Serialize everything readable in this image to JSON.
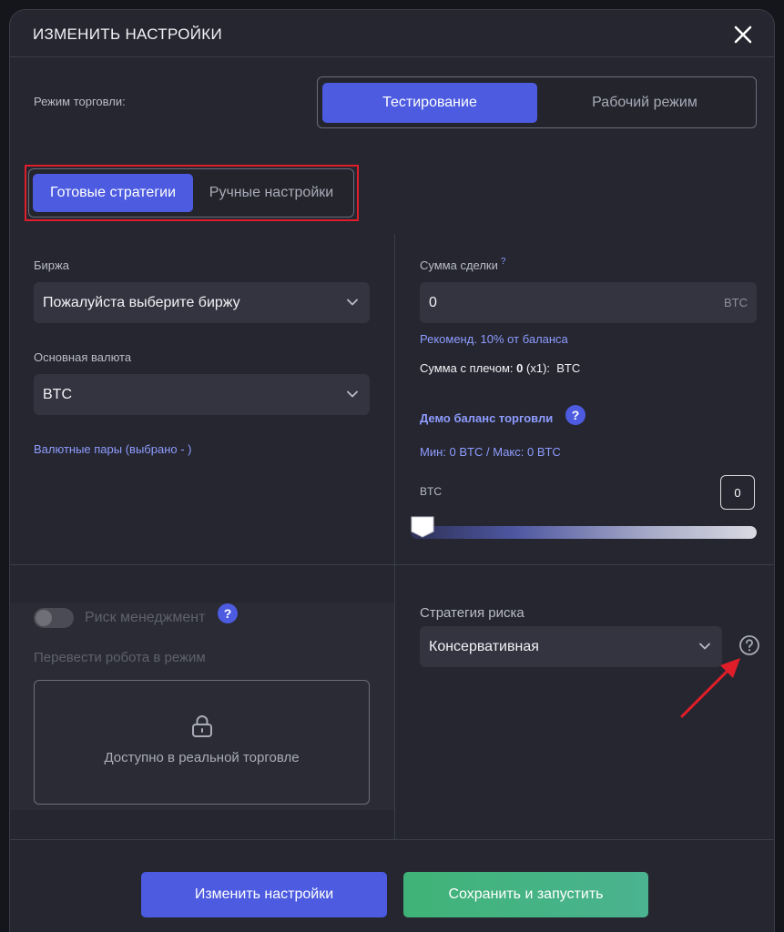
{
  "modal": {
    "title": "ИЗМЕНИТЬ НАСТРОЙКИ",
    "close_icon": "close-icon"
  },
  "trading_mode": {
    "label": "Режим торговли:",
    "options": [
      {
        "label": "Тестирование",
        "active": true
      },
      {
        "label": "Рабочий режим",
        "active": false
      }
    ]
  },
  "strategy_tabs": {
    "options": [
      {
        "label": "Готовые стратегии",
        "active": true
      },
      {
        "label": "Ручные настройки",
        "active": false
      }
    ]
  },
  "exchange": {
    "label": "Биржа",
    "value": "Пожалуйста выберите биржу"
  },
  "base_currency": {
    "label": "Основная валюта",
    "value": "BTC"
  },
  "pairs_link": "Валютные пары (выбрано - )",
  "trade_amount": {
    "label": "Сумма сделки",
    "help": "?",
    "value": "0",
    "unit": "BTC",
    "recommend": "Рекоменд. 10% от баланса",
    "leverage_prefix": "Сумма с плечом:",
    "leverage_value": "0",
    "leverage_mult": "(x1):",
    "leverage_unit": "BTC"
  },
  "demo_balance": {
    "label": "Демо баланс торговли",
    "help": "?",
    "min": "Мин: 0 BTC",
    "sep": "/",
    "max": "Макс: 0 BTC",
    "unit": "BTC",
    "value": "0",
    "slider_fraction": 0
  },
  "risk_management": {
    "label": "Риск менеджмент",
    "help": "?",
    "enabled": false,
    "robot_label": "Перевести робота в режим",
    "locked_text": "Доступно в реальной торговле"
  },
  "risk_strategy": {
    "label": "Стратегия риска",
    "value": "Консервативная"
  },
  "footer": {
    "change_label": "Изменить настройки",
    "save_label": "Сохранить и запустить"
  },
  "colors": {
    "accent": "#4c5be0",
    "success": "#3fb377",
    "highlight": "#e01e2a"
  }
}
